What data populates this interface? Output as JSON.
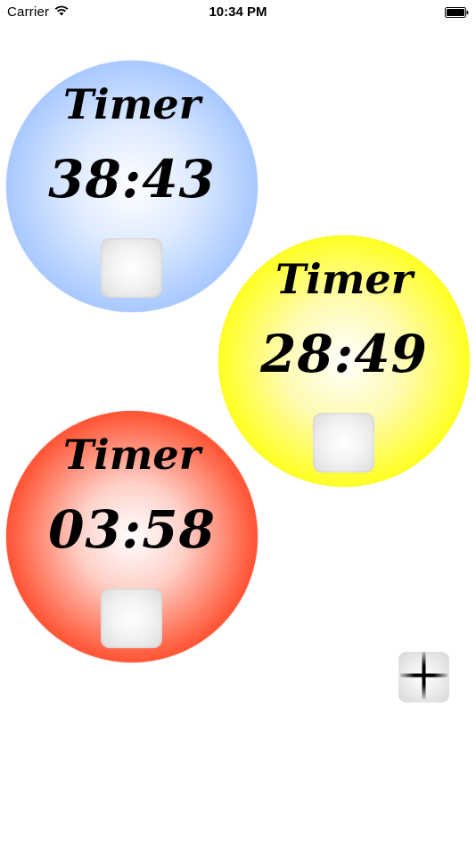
{
  "status_bar": {
    "carrier": "Carrier",
    "time": "10:34 PM",
    "wifi_icon": "wifi-icon",
    "battery_icon": "battery-icon"
  },
  "timers": [
    {
      "title": "Timer",
      "time": "38:43",
      "color": "#8cb7ff",
      "button_icon": "blank-square"
    },
    {
      "title": "Timer",
      "time": "28:49",
      "color": "#f7f000",
      "button_icon": "blank-square"
    },
    {
      "title": "Timer",
      "time": "03:58",
      "color": "#ff2a08",
      "button_icon": "blank-square"
    }
  ],
  "add_button": {
    "icon": "plus-icon"
  }
}
